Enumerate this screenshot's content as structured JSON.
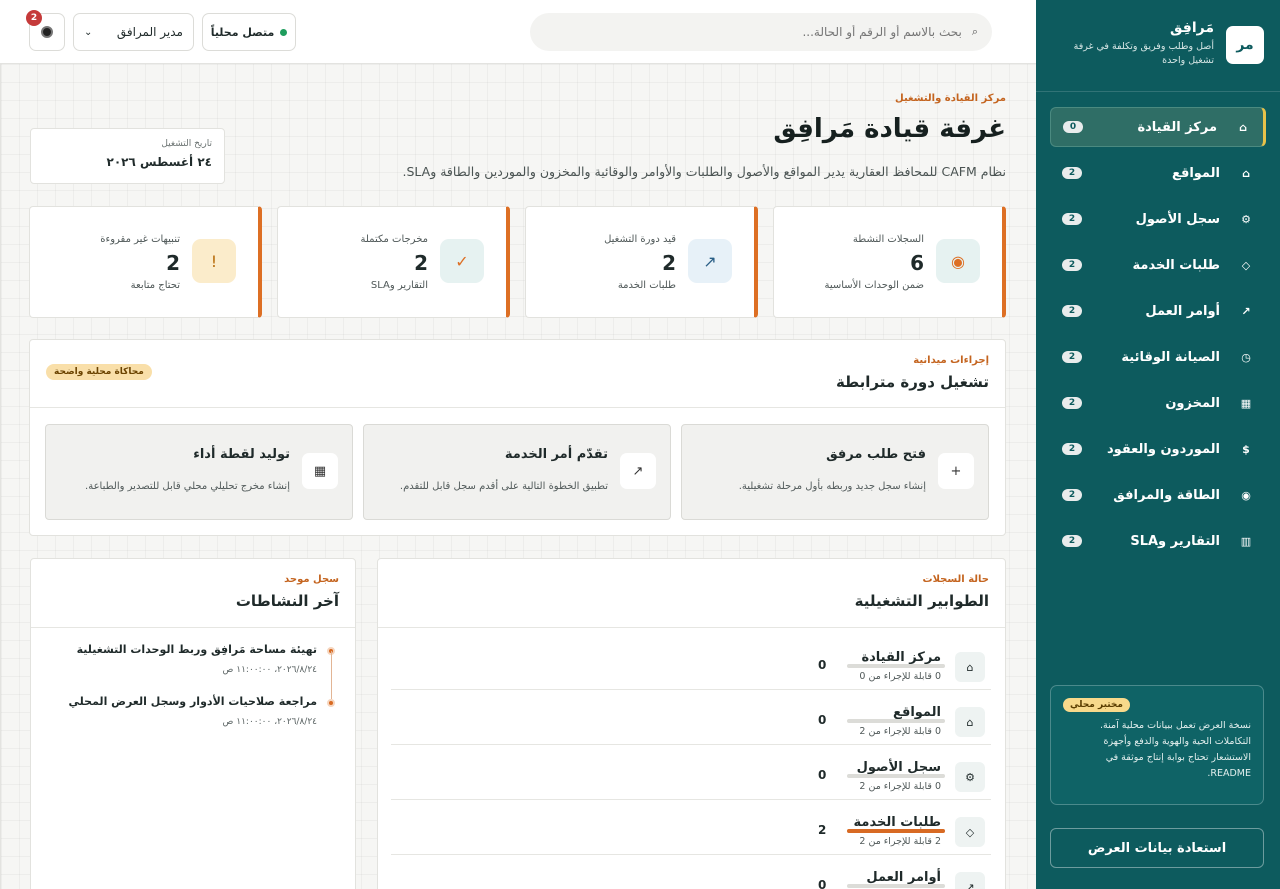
{
  "brand": {
    "logo": "مر",
    "name": "مَرافِق",
    "tagline": "أصل وطلب وفريق وتكلفة في غرفة تشغيل واحدة"
  },
  "nav": [
    {
      "label": "مركز القيادة",
      "badge": "0",
      "icon": "home-icon",
      "glyph": "⌂",
      "active": true
    },
    {
      "label": "المواقع",
      "badge": "2",
      "icon": "home-icon",
      "glyph": "⌂"
    },
    {
      "label": "سجل الأصول",
      "badge": "2",
      "icon": "gear-icon",
      "glyph": "⚙"
    },
    {
      "label": "طلبات الخدمة",
      "badge": "2",
      "icon": "diamond-icon",
      "glyph": "◇"
    },
    {
      "label": "أوامر العمل",
      "badge": "2",
      "icon": "arrow-up-right-icon",
      "glyph": "↗"
    },
    {
      "label": "الصيانة الوقائية",
      "badge": "2",
      "icon": "clock-icon",
      "glyph": "◷"
    },
    {
      "label": "المخزون",
      "badge": "2",
      "icon": "box-icon",
      "glyph": "▦"
    },
    {
      "label": "الموردون والعقود",
      "badge": "2",
      "icon": "dollar-icon",
      "glyph": "$"
    },
    {
      "label": "الطاقة والمرافق",
      "badge": "2",
      "icon": "energy-icon",
      "glyph": "◉"
    },
    {
      "label": "التقارير وSLA",
      "badge": "2",
      "icon": "report-icon",
      "glyph": "▥"
    }
  ],
  "sim": {
    "chip": "مختبر محلي",
    "text": "نسخة العرض تعمل ببيانات محلية آمنة. التكاملات الحية والهوية والدفع وأجهزة الاستشعار تحتاج بوابة إنتاج موثقة في README."
  },
  "restore_label": "استعادة بيانات العرض",
  "topbar": {
    "search_placeholder": "بحث بالاسم أو الرقم أو الحالة...",
    "connection": "متصل محلياً",
    "role": "مدير المرافق",
    "notifications": "2"
  },
  "header": {
    "eyebrow": "مركز القيادة والتشغيل",
    "title": "غرفة قيادة مَرافِق",
    "subtitle": "نظام CAFM للمحافظ العقارية يدير المواقع والأصول والطلبات والأوامر والوقائية والمخزون والموردين والطاقة وSLA."
  },
  "date_card": {
    "label": "تاريخ التشغيل",
    "value": "٢٤ أغسطس ٢٠٢٦"
  },
  "kpis": [
    {
      "label": "السجلات النشطة",
      "value": "6",
      "desc": "ضمن الوحدات الأساسية",
      "glyph": "◉",
      "icon": "target-icon",
      "bg": "#e6f2f1",
      "fg": "#dd6f24"
    },
    {
      "label": "قيد دورة التشغيل",
      "value": "2",
      "desc": "طلبات الخدمة",
      "glyph": "↗",
      "icon": "arrow-up-right-icon",
      "bg": "#e7f1f8",
      "fg": "#2a5f86"
    },
    {
      "label": "مخرجات مكتملة",
      "value": "2",
      "desc": "التقارير وSLA",
      "glyph": "✓",
      "icon": "check-icon",
      "bg": "#e6f2f1",
      "fg": "#dd6f24"
    },
    {
      "label": "تنبيهات غير مقروءة",
      "value": "2",
      "desc": "تحتاج متابعة",
      "glyph": "!",
      "icon": "alert-icon",
      "bg": "#fbeccb",
      "fg": "#b86d0c"
    }
  ],
  "actions_panel": {
    "eyebrow": "إجراءات ميدانية",
    "title": "تشغيل دورة مترابطة",
    "chip": "محاكاة محلية واضحة",
    "items": [
      {
        "title": "فتح طلب مرفق",
        "desc": "إنشاء سجل جديد وربطه بأول مرحلة تشغيلية.",
        "glyph": "+",
        "icon": "plus-icon"
      },
      {
        "title": "تقدّم أمر الخدمة",
        "desc": "تطبيق الخطوة التالية على أقدم سجل قابل للتقدم.",
        "glyph": "↗",
        "icon": "arrow-up-right-icon"
      },
      {
        "title": "توليد لقطة أداء",
        "desc": "إنشاء مخرج تحليلي محلي قابل للتصدير والطباعة.",
        "glyph": "▦",
        "icon": "snapshot-icon"
      }
    ]
  },
  "queues_panel": {
    "eyebrow": "حالة السجلات",
    "title": "الطوابير التشغيلية",
    "rows": [
      {
        "name": "مركز القيادة",
        "meta": "0 قابلة للإجراء من 0",
        "count": "0",
        "progress": 0,
        "glyph": "⌂",
        "icon": "home-icon"
      },
      {
        "name": "المواقع",
        "meta": "0 قابلة للإجراء من 2",
        "count": "0",
        "progress": 0,
        "glyph": "⌂",
        "icon": "home-icon"
      },
      {
        "name": "سجل الأصول",
        "meta": "0 قابلة للإجراء من 2",
        "count": "0",
        "progress": 0,
        "glyph": "⚙",
        "icon": "gear-icon"
      },
      {
        "name": "طلبات الخدمة",
        "meta": "2 قابلة للإجراء من 2",
        "count": "2",
        "progress": 1,
        "glyph": "◇",
        "icon": "diamond-icon"
      },
      {
        "name": "أوامر العمل",
        "meta": "",
        "count": "0",
        "progress": 0,
        "glyph": "↗",
        "icon": "arrow-up-right-icon"
      }
    ]
  },
  "activity_panel": {
    "eyebrow": "سجل موحد",
    "title": "آخر النشاطات",
    "items": [
      {
        "title": "تهيئة مساحة مَرافِق وربط الوحدات التشغيلية",
        "date": "٢٠٢٦/٨/٢٤، ١١:٠٠:٠٠ ص"
      },
      {
        "title": "مراجعة صلاحيات الأدوار وسجل العرض المحلي",
        "date": "٢٠٢٦/٨/٢٤، ١١:٠٠:٠٠ ص"
      }
    ]
  }
}
